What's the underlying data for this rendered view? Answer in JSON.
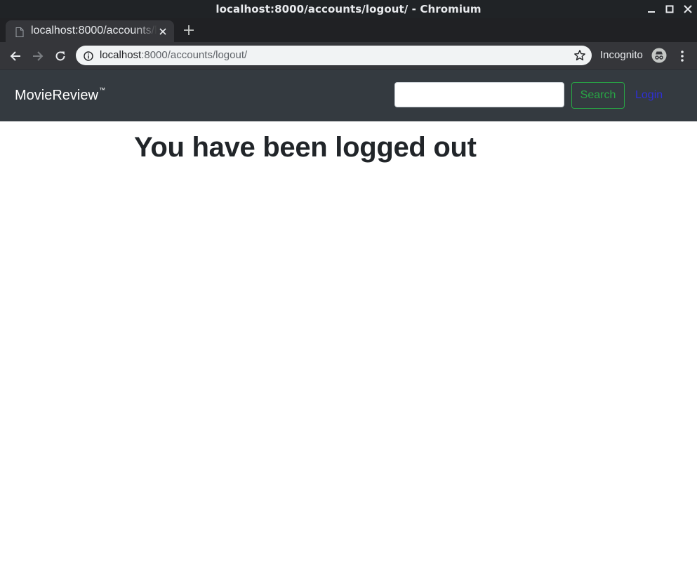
{
  "window": {
    "title": "localhost:8000/accounts/logout/ - Chromium"
  },
  "browser": {
    "tab_title": "localhost:8000/accounts/logout/",
    "url_host": "localhost",
    "url_rest": ":8000/accounts/logout/",
    "incognito_label": "Incognito"
  },
  "site": {
    "brand": "MovieReview",
    "brand_mark": "™",
    "search_value": "",
    "search_button": "Search",
    "login_link": "Login"
  },
  "main": {
    "heading": "You have been logged out"
  },
  "colors": {
    "navbar_bg": "#343a40",
    "search_button": "#28a745",
    "login_link": "#2f2fd6"
  }
}
